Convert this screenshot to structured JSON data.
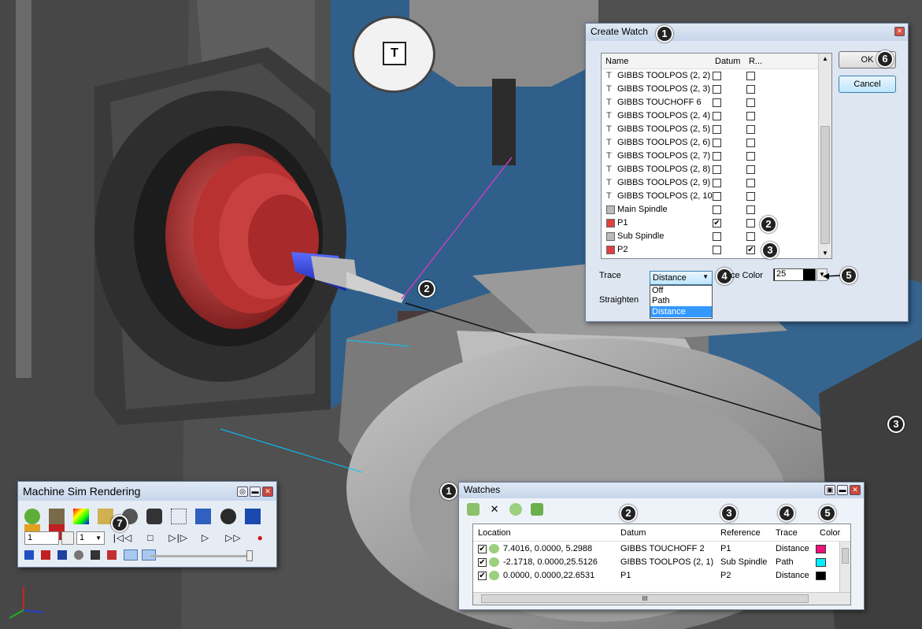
{
  "create_watch": {
    "title": "Create Watch",
    "columns": [
      "Name",
      "Datum",
      "R..."
    ],
    "items": [
      {
        "name": "GIBBS TOOLPOS (2, 2)",
        "icon": "tool-icon",
        "datum": false,
        "ref": false
      },
      {
        "name": "GIBBS TOOLPOS (2, 3)",
        "icon": "tool-icon",
        "datum": false,
        "ref": false
      },
      {
        "name": "GIBBS TOUCHOFF 6",
        "icon": "tool-icon",
        "datum": false,
        "ref": false
      },
      {
        "name": "GIBBS TOOLPOS (2, 4)",
        "icon": "tool-icon",
        "datum": false,
        "ref": false
      },
      {
        "name": "GIBBS TOOLPOS (2, 5)",
        "icon": "tool-icon",
        "datum": false,
        "ref": false
      },
      {
        "name": "GIBBS TOOLPOS (2, 6)",
        "icon": "tool-icon",
        "datum": false,
        "ref": false
      },
      {
        "name": "GIBBS TOOLPOS (2, 7)",
        "icon": "tool-icon",
        "datum": false,
        "ref": false
      },
      {
        "name": "GIBBS TOOLPOS (2, 8)",
        "icon": "tool-icon",
        "datum": false,
        "ref": false
      },
      {
        "name": "GIBBS TOOLPOS (2, 9)",
        "icon": "tool-icon",
        "datum": false,
        "ref": false
      },
      {
        "name": "GIBBS TOOLPOS (2, 10)",
        "icon": "tool-icon",
        "datum": false,
        "ref": false
      },
      {
        "name": "Main Spindle",
        "icon": "spindle-icon",
        "datum": false,
        "ref": false
      },
      {
        "name": "P1",
        "icon": "point-icon",
        "datum": true,
        "ref": false
      },
      {
        "name": "Sub Spindle",
        "icon": "spindle-icon",
        "datum": false,
        "ref": false
      },
      {
        "name": "P2",
        "icon": "point-icon",
        "datum": false,
        "ref": true
      }
    ],
    "ok_label": "OK",
    "cancel_label": "Cancel",
    "trace_label": "Trace",
    "trace_value": "Distance",
    "trace_options": [
      "Off",
      "Path",
      "Distance"
    ],
    "trace_color_label": "ce Color",
    "trace_color_value": "25",
    "straighten_label": "Straighten"
  },
  "watches": {
    "title": "Watches",
    "columns": [
      "Location",
      "Datum",
      "Reference",
      "Trace",
      "Color"
    ],
    "rows": [
      {
        "location": "7.4016, 0.0000, 5.2988",
        "datum": "GIBBS TOUCHOFF 2",
        "reference": "P1",
        "trace": "Distance",
        "color": "#ee1177",
        "checked": true
      },
      {
        "location": "-2.1718, 0.0000,25.5126",
        "datum": "GIBBS TOOLPOS (2, 1)",
        "reference": "Sub Spindle",
        "trace": "Path",
        "color": "#00f0ff",
        "checked": true
      },
      {
        "location": "0.0000, 0.0000,22.6531",
        "datum": "P1",
        "reference": "P2",
        "trace": "Distance",
        "color": "#000000",
        "checked": true
      }
    ],
    "scroll_grip": "III"
  },
  "machine_sim": {
    "title": "Machine Sim Rendering",
    "step_value": "1",
    "speed_value": "1"
  },
  "callouts": {
    "cw1": "1",
    "cw2": "2",
    "cw3": "3",
    "cw4": "4",
    "cw5": "5",
    "cw6": "6",
    "vp2": "2",
    "vp3": "3",
    "ms7": "7",
    "w1": "1",
    "w2": "2",
    "w3": "3",
    "w4": "4",
    "w5": "5"
  },
  "colors": {
    "accent_blue": "#3399ff",
    "viewport_blue": "#2f5f8a",
    "part_red": "#c03838"
  }
}
